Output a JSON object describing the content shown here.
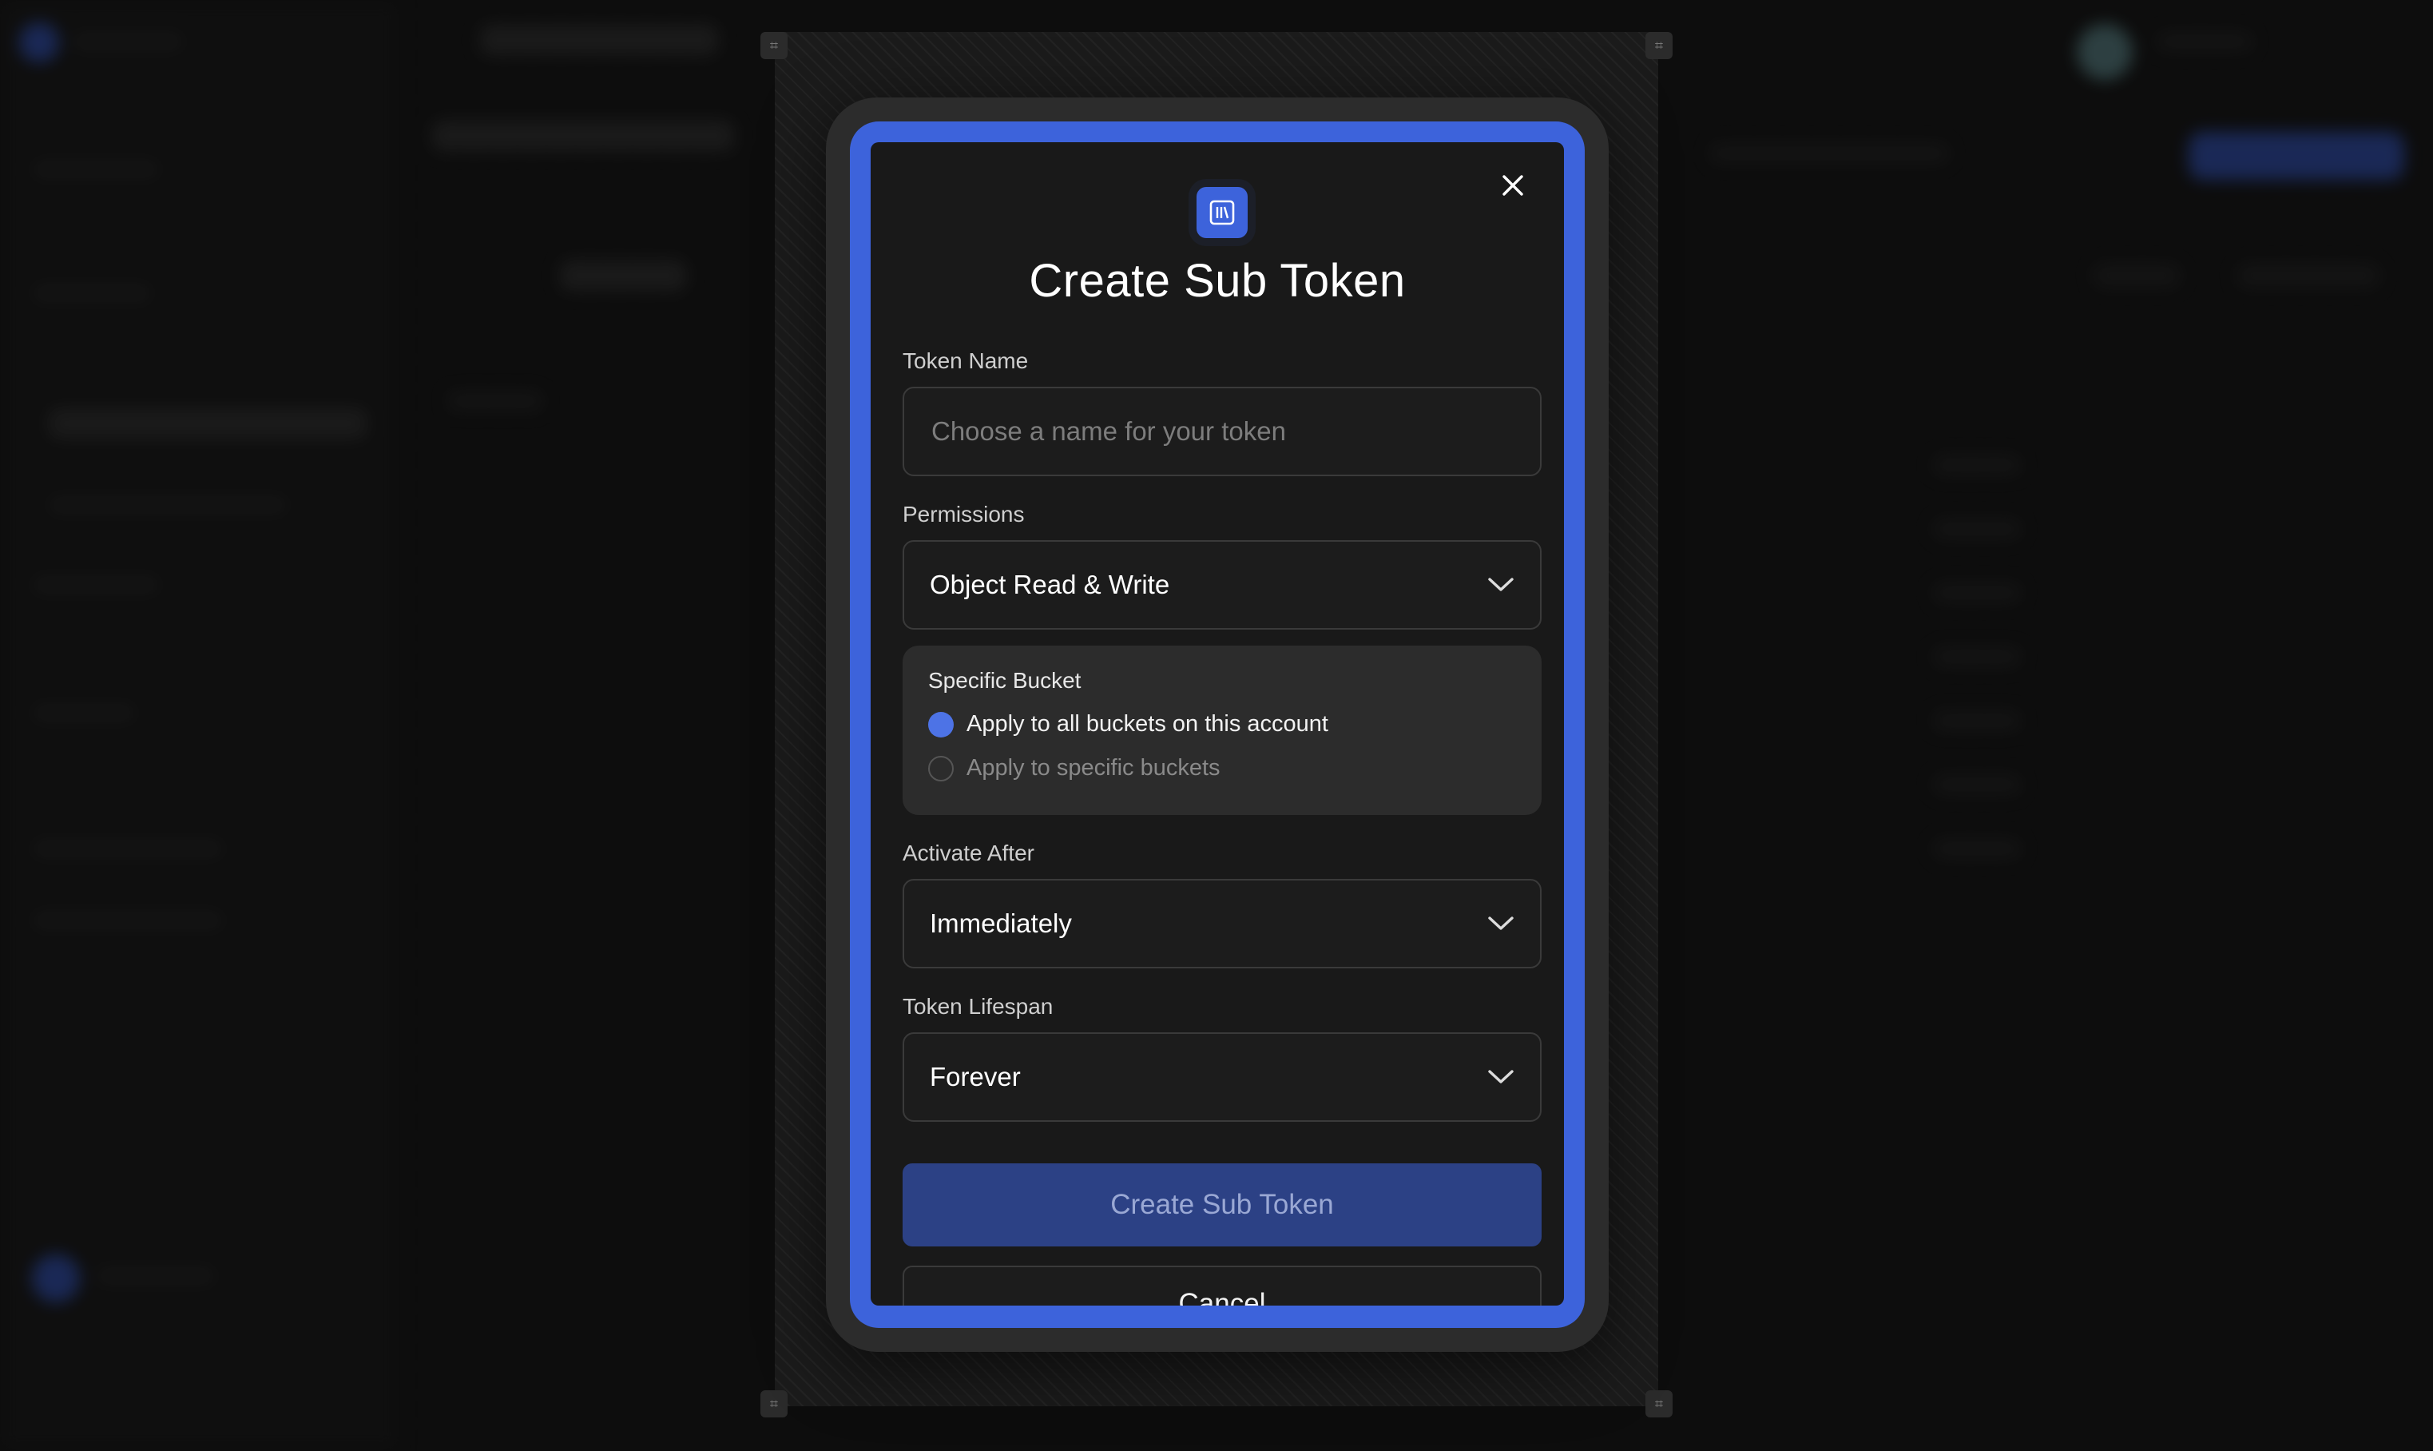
{
  "modal": {
    "title": "Create Sub Token",
    "token_name": {
      "label": "Token Name",
      "placeholder": "Choose a name for your token",
      "value": ""
    },
    "permissions": {
      "label": "Permissions",
      "selected": "Object Read & Write"
    },
    "specific_bucket": {
      "title": "Specific Bucket",
      "options": [
        {
          "label": "Apply to all buckets on this account",
          "selected": true
        },
        {
          "label": "Apply to specific buckets",
          "selected": false
        }
      ]
    },
    "activate_after": {
      "label": "Activate After",
      "selected": "Immediately"
    },
    "token_lifespan": {
      "label": "Token Lifespan",
      "selected": "Forever"
    },
    "create_button": "Create Sub Token",
    "cancel_button": "Cancel"
  },
  "icons": {
    "close": "close-icon",
    "header": "bucket-icon",
    "dropdown": "chevron-down-icon"
  },
  "colors": {
    "accent": "#3d63db",
    "primary_button": "#2c4185",
    "background": "#141414"
  }
}
